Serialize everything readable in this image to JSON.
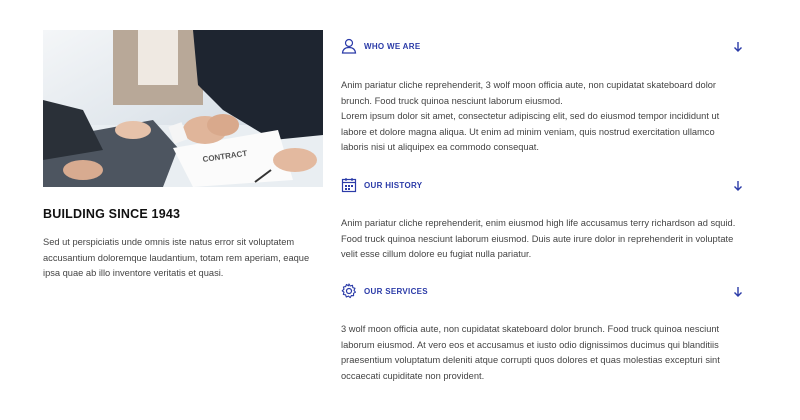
{
  "left": {
    "title": "BUILDING SINCE 1943",
    "text": "Sed ut perspiciatis unde omnis iste natus error sit voluptatem accusantium doloremque laudantium, totam rem aperiam, eaque ipsa quae ab illo inventore veritatis et quasi.",
    "image": {
      "subject": "handshake over contract",
      "contract_text": "CONTRACT"
    }
  },
  "accordion": [
    {
      "icon": "user-icon",
      "title": "WHO WE ARE",
      "paragraphs": [
        "Anim pariatur cliche reprehenderit, 3 wolf moon officia aute, non cupidatat skateboard dolor brunch. Food truck quinoa nesciunt laborum eiusmod.",
        "Lorem ipsum dolor sit amet, consectetur adipiscing elit, sed do eiusmod tempor incididunt ut labore et dolore magna aliqua. Ut enim ad minim veniam, quis nostrud exercitation ullamco laboris nisi ut aliquipex ea commodo consequat."
      ]
    },
    {
      "icon": "calendar-icon",
      "title": "OUR HISTORY",
      "paragraphs": [
        "Anim pariatur cliche reprehenderit, enim eiusmod high life accusamus terry richardson ad squid. Food truck quinoa nesciunt laborum eiusmod. Duis aute irure dolor in reprehenderit in voluptate velit esse cillum dolore eu fugiat nulla pariatur."
      ]
    },
    {
      "icon": "gear-icon",
      "title": "OUR SERVICES",
      "paragraphs": [
        "3 wolf moon officia aute, non cupidatat skateboard dolor brunch. Food truck quinoa nesciunt laborum eiusmod. At vero eos et accusamus et iusto odio dignissimos ducimus qui blanditiis praesentium voluptatum deleniti atque corrupti quos dolores et quas molestias excepturi sint occaecati cupiditate non provident."
      ]
    }
  ],
  "colors": {
    "accent": "#2b3ba8",
    "heading": "#111111",
    "text": "#444444"
  }
}
